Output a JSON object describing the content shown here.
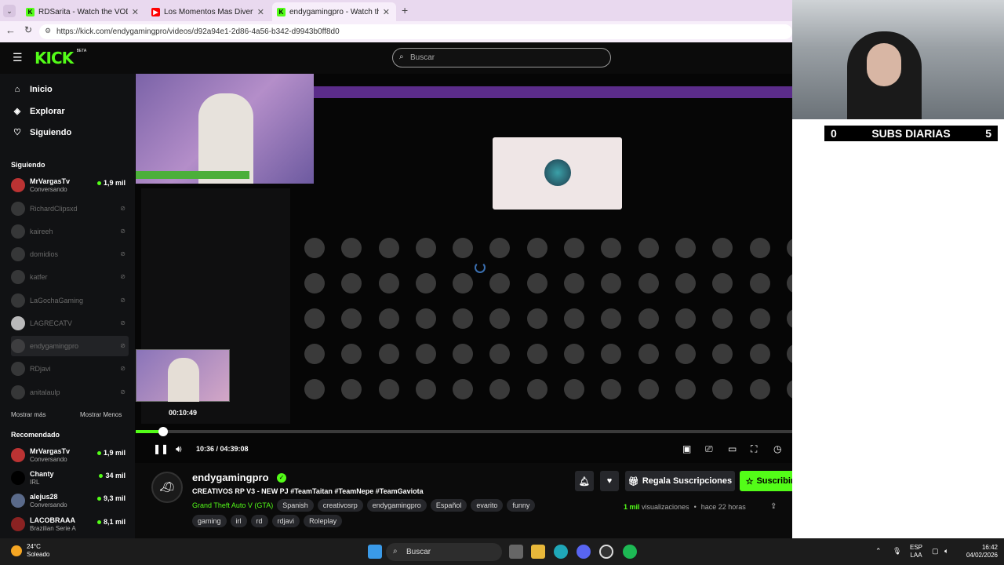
{
  "browser": {
    "tabs": [
      {
        "title": "RDSarita - Watch the VOD on Kick",
        "favicon_color": "#53fc18",
        "active": false
      },
      {
        "title": "Los Momentos Mas Divertidos de",
        "favicon_color": "#ff0000",
        "active": false
      },
      {
        "title": "endygamingpro - Watch the VOD",
        "favicon_color": "#53fc18",
        "active": true
      }
    ],
    "url": "https://kick.com/endygamingpro/videos/d92a94e1-2d86-4a56-b342-d9943b0ff8d0"
  },
  "kick": {
    "logo": "KICK",
    "logo_badge": "BETA",
    "search_placeholder": "Buscar",
    "nav": [
      {
        "label": "Inicio",
        "icon": "home-icon"
      },
      {
        "label": "Explorar",
        "icon": "compass-icon"
      },
      {
        "label": "Siguiendo",
        "icon": "heart-icon"
      }
    ],
    "following_title": "Siguiendo",
    "following": [
      {
        "name": "MrVargasTv",
        "sub": "Conversando",
        "count": "1,9 mil",
        "live": true
      },
      {
        "name": "RichardClipsxd",
        "live": false
      },
      {
        "name": "kaireeh",
        "live": false
      },
      {
        "name": "domidios",
        "live": false
      },
      {
        "name": "katfer",
        "live": false
      },
      {
        "name": "LaGochaGaming",
        "live": false
      },
      {
        "name": "LAGRECATV",
        "live": false
      },
      {
        "name": "endygamingpro",
        "live": false,
        "selected": true
      },
      {
        "name": "RDjavi",
        "live": false
      },
      {
        "name": "anitalaulp",
        "live": false
      }
    ],
    "show_more": "Mostrar más",
    "show_less": "Mostrar Menos",
    "recommended_title": "Recomendado",
    "recommended": [
      {
        "name": "MrVargasTv",
        "sub": "Conversando",
        "count": "1,9 mil"
      },
      {
        "name": "Chanty",
        "sub": "IRL",
        "count": "34 mil"
      },
      {
        "name": "alejus28",
        "sub": "Conversando",
        "count": "9,3 mil"
      },
      {
        "name": "LACOBRAAA",
        "sub": "Brazilian Serie A",
        "count": "8,1 mil"
      }
    ]
  },
  "player": {
    "preview_time": "00:10:49",
    "time": "10:36 / 04:39:08",
    "progress": 0.04
  },
  "stream": {
    "channel": "endygamingpro",
    "title": "CREATIVOS RP V3 - NEW PJ  #TeamTaitan #TeamNepe #TeamGaviota",
    "game": "Grand Theft Auto V (GTA)",
    "tags_row1": [
      "Spanish",
      "creativosrp",
      "endygamingpro",
      "Español",
      "evarito",
      "funny"
    ],
    "tags_row2": [
      "gaming",
      "irl",
      "rd",
      "rdjavi",
      "Roleplay"
    ],
    "gift_label": "Regala Suscripciones",
    "subscribe_label": "Suscribirse",
    "views_count": "1 mil",
    "views_label": "visualizaciones",
    "ago": "hace 22 horas"
  },
  "overlay": {
    "left_count": "0",
    "label": "SUBS DIARIAS",
    "right_count": "5"
  },
  "taskbar": {
    "temp": "24°C",
    "weather": "Soleado",
    "search": "Buscar",
    "lang1": "ESP",
    "lang2": "LAA",
    "time": "16:42",
    "date": "04/02/2026"
  }
}
